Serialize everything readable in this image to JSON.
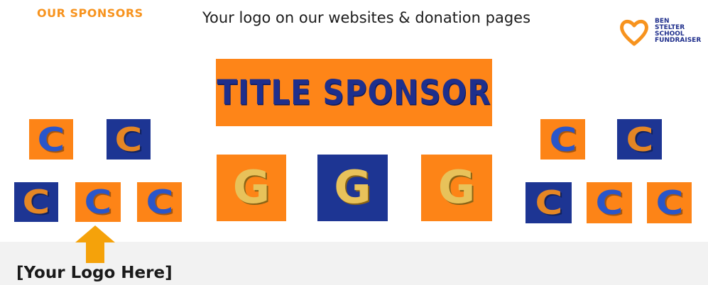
{
  "header": {
    "section_title": "OUR SPONSORS",
    "subtitle": "Your logo on our websites & donation pages"
  },
  "brand": {
    "icon": "heart-icon",
    "line1": "BEN",
    "line2": "STELTER",
    "line3": "SCHOOL",
    "line4": "FUNDRAISER",
    "colors": {
      "heart": "#f7931e",
      "text": "#1f2f8c"
    }
  },
  "title_sponsor": {
    "label": "TITLE SPONSOR"
  },
  "gold_tiles": {
    "letter": "G"
  },
  "community_tiles": {
    "letter": "C"
  },
  "callout": {
    "text": "[Your Logo Here]",
    "arrow_icon": "arrow-up-icon",
    "arrow_color": "#f5a20a"
  },
  "colors": {
    "orange": "#fd8417",
    "blue": "#1d3593",
    "gold": "#e8c25a"
  }
}
